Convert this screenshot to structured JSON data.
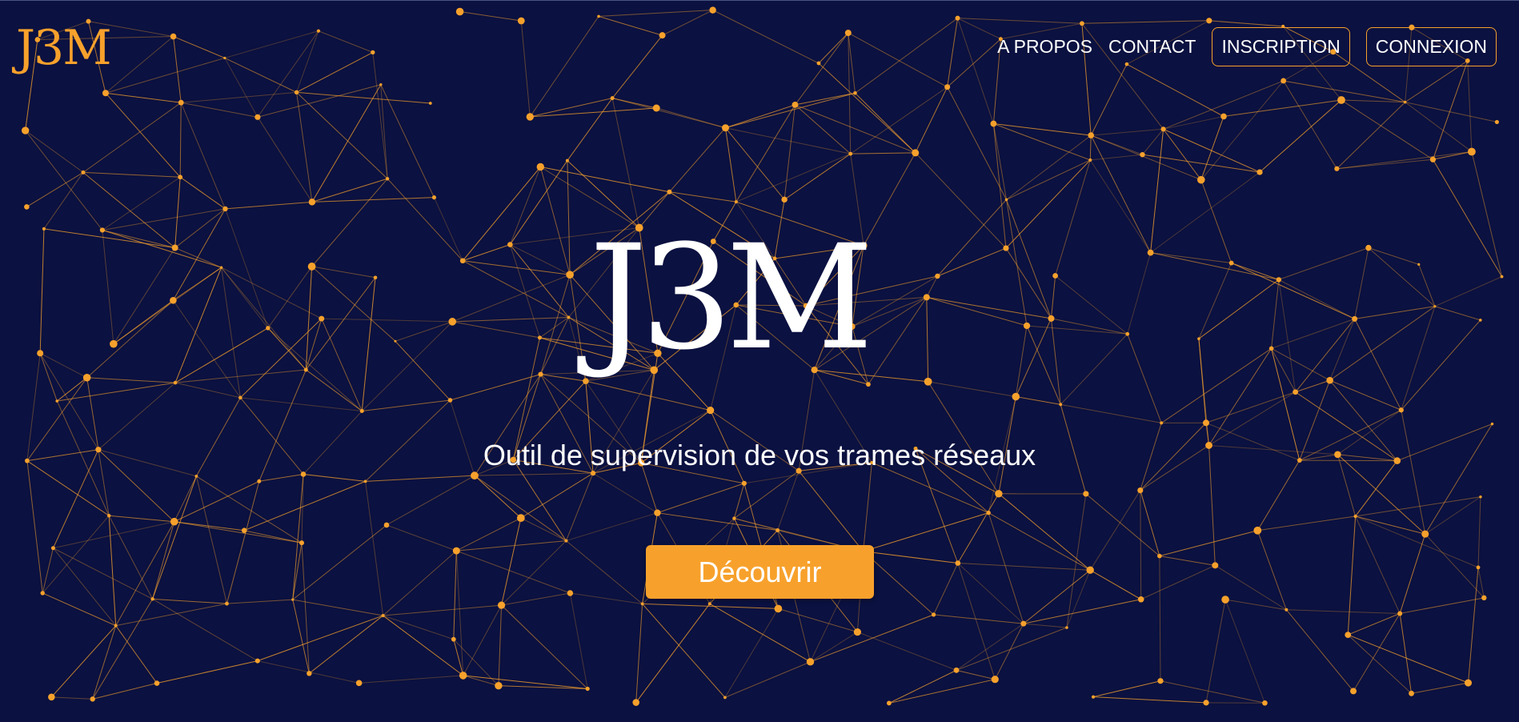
{
  "brand": {
    "logo_text": "J3M"
  },
  "nav": {
    "about": "A PROPOS",
    "contact": "CONTACT",
    "signup": "INSCRIPTION",
    "login": "CONNEXION"
  },
  "hero": {
    "logo_text": "J3M",
    "tagline": "Outil de supervision de vos trames réseaux",
    "cta_label": "Découvrir"
  },
  "colors": {
    "background": "#0b1140",
    "accent": "#f7a12c",
    "text": "#ffffff"
  }
}
